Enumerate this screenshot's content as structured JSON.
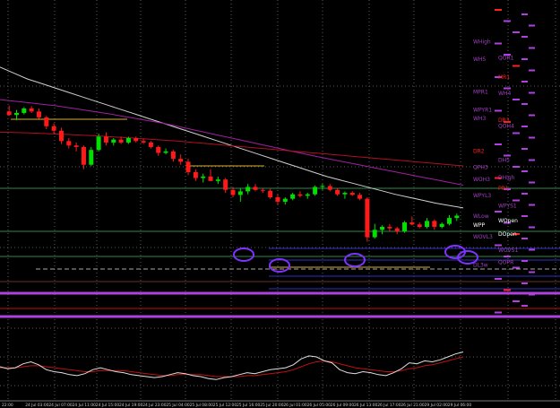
{
  "chart_data": {
    "type": "candlestick",
    "x_ticks": [
      "22:00",
      "24 Jul 03:00",
      "24 Jul 07:00",
      "24 Jul 11:00",
      "24 Jul 15:00",
      "24 Jul 19:00",
      "24 Jul 23:00",
      "25 Jul 04:00",
      "25 Jul 08:00",
      "25 Jul 12:00",
      "25 Jul 16:00",
      "25 Jul 20:00",
      "26 Jul 01:00",
      "26 Jul 05:00",
      "26 Jul 09:00",
      "26 Jul 13:00",
      "26 Jul 17:00",
      "26 Jul 21:00",
      "29 Jul 02:00",
      "29 Jul 06:00"
    ],
    "candles": [
      {
        "o": 69.0,
        "h": 71.0,
        "l": 67.5,
        "c": 67.8
      },
      {
        "o": 67.8,
        "h": 69.5,
        "l": 66.0,
        "c": 68.5
      },
      {
        "o": 68.5,
        "h": 70.5,
        "l": 68.0,
        "c": 70.0
      },
      {
        "o": 70.0,
        "h": 70.8,
        "l": 68.5,
        "c": 69.0
      },
      {
        "o": 69.0,
        "h": 70.0,
        "l": 66.5,
        "c": 67.0
      },
      {
        "o": 67.0,
        "h": 67.5,
        "l": 63.0,
        "c": 64.0
      },
      {
        "o": 64.0,
        "h": 65.0,
        "l": 61.5,
        "c": 62.5
      },
      {
        "o": 62.5,
        "h": 63.5,
        "l": 58.0,
        "c": 59.0
      },
      {
        "o": 59.0,
        "h": 60.0,
        "l": 56.5,
        "c": 57.5
      },
      {
        "o": 57.5,
        "h": 58.5,
        "l": 55.5,
        "c": 57.0
      },
      {
        "o": 57.0,
        "h": 57.5,
        "l": 49.5,
        "c": 51.0
      },
      {
        "o": 51.0,
        "h": 57.0,
        "l": 50.5,
        "c": 56.0
      },
      {
        "o": 56.0,
        "h": 61.5,
        "l": 55.5,
        "c": 60.5
      },
      {
        "o": 60.5,
        "h": 62.0,
        "l": 57.5,
        "c": 58.5
      },
      {
        "o": 58.5,
        "h": 60.0,
        "l": 57.5,
        "c": 59.5
      },
      {
        "o": 59.5,
        "h": 60.5,
        "l": 58.0,
        "c": 58.5
      },
      {
        "o": 58.5,
        "h": 60.5,
        "l": 58.0,
        "c": 60.0
      },
      {
        "o": 60.0,
        "h": 60.5,
        "l": 58.5,
        "c": 59.0
      },
      {
        "o": 59.0,
        "h": 59.8,
        "l": 58.0,
        "c": 58.5
      },
      {
        "o": 58.5,
        "h": 59.0,
        "l": 56.5,
        "c": 57.0
      },
      {
        "o": 57.0,
        "h": 57.5,
        "l": 54.0,
        "c": 55.0
      },
      {
        "o": 55.0,
        "h": 56.5,
        "l": 54.5,
        "c": 55.5
      },
      {
        "o": 55.5,
        "h": 56.0,
        "l": 52.0,
        "c": 53.0
      },
      {
        "o": 53.0,
        "h": 54.5,
        "l": 51.0,
        "c": 52.0
      },
      {
        "o": 52.0,
        "h": 53.0,
        "l": 47.5,
        "c": 48.5
      },
      {
        "o": 48.5,
        "h": 49.5,
        "l": 45.5,
        "c": 46.5
      },
      {
        "o": 46.5,
        "h": 48.0,
        "l": 45.0,
        "c": 47.0
      },
      {
        "o": 47.0,
        "h": 49.5,
        "l": 46.5,
        "c": 45.5
      },
      {
        "o": 45.5,
        "h": 47.0,
        "l": 44.5,
        "c": 46.0
      },
      {
        "o": 46.0,
        "h": 46.5,
        "l": 41.5,
        "c": 42.5
      },
      {
        "o": 42.5,
        "h": 43.5,
        "l": 40.0,
        "c": 40.8
      },
      {
        "o": 40.8,
        "h": 43.0,
        "l": 38.5,
        "c": 42.0
      },
      {
        "o": 42.0,
        "h": 44.5,
        "l": 41.0,
        "c": 43.5
      },
      {
        "o": 43.5,
        "h": 44.5,
        "l": 42.0,
        "c": 42.5
      },
      {
        "o": 42.5,
        "h": 43.0,
        "l": 41.5,
        "c": 42.2
      },
      {
        "o": 42.2,
        "h": 42.8,
        "l": 39.5,
        "c": 40.0
      },
      {
        "o": 40.0,
        "h": 41.0,
        "l": 37.5,
        "c": 38.5
      },
      {
        "o": 38.5,
        "h": 40.0,
        "l": 37.5,
        "c": 39.5
      },
      {
        "o": 39.5,
        "h": 41.5,
        "l": 39.0,
        "c": 41.0
      },
      {
        "o": 41.0,
        "h": 42.0,
        "l": 40.0,
        "c": 40.5
      },
      {
        "o": 40.5,
        "h": 41.5,
        "l": 39.5,
        "c": 41.0
      },
      {
        "o": 41.0,
        "h": 44.0,
        "l": 40.5,
        "c": 43.5
      },
      {
        "o": 43.5,
        "h": 44.5,
        "l": 42.5,
        "c": 43.8
      },
      {
        "o": 43.8,
        "h": 44.5,
        "l": 42.0,
        "c": 42.5
      },
      {
        "o": 42.5,
        "h": 43.0,
        "l": 40.5,
        "c": 41.0
      },
      {
        "o": 41.0,
        "h": 42.0,
        "l": 39.5,
        "c": 41.5
      },
      {
        "o": 41.5,
        "h": 42.0,
        "l": 40.5,
        "c": 40.8
      },
      {
        "o": 40.8,
        "h": 41.5,
        "l": 39.0,
        "c": 39.5
      },
      {
        "o": 39.5,
        "h": 40.0,
        "l": 25.0,
        "c": 26.5
      },
      {
        "o": 26.5,
        "h": 31.0,
        "l": 26.0,
        "c": 29.0
      },
      {
        "o": 29.0,
        "h": 30.5,
        "l": 27.5,
        "c": 30.0
      },
      {
        "o": 30.0,
        "h": 31.0,
        "l": 28.5,
        "c": 29.5
      },
      {
        "o": 29.5,
        "h": 30.0,
        "l": 27.5,
        "c": 28.5
      },
      {
        "o": 28.5,
        "h": 32.0,
        "l": 28.0,
        "c": 31.5
      },
      {
        "o": 31.5,
        "h": 33.5,
        "l": 30.5,
        "c": 30.8
      },
      {
        "o": 30.8,
        "h": 31.5,
        "l": 29.5,
        "c": 30.0
      },
      {
        "o": 30.0,
        "h": 33.0,
        "l": 29.5,
        "c": 32.0
      },
      {
        "o": 32.0,
        "h": 32.5,
        "l": 29.0,
        "c": 30.0
      },
      {
        "o": 30.0,
        "h": 31.5,
        "l": 29.5,
        "c": 31.0
      },
      {
        "o": 31.0,
        "h": 34.0,
        "l": 30.5,
        "c": 33.0
      },
      {
        "o": 33.0,
        "h": 34.5,
        "l": 32.0,
        "c": 33.8
      }
    ],
    "moving_averages": [
      {
        "color": "#cfcfcf",
        "values": [
          84,
          82,
          80,
          78.5,
          77,
          75.5,
          74,
          72.5,
          71,
          69.5,
          68,
          66.5,
          65,
          63.5,
          62,
          60.5,
          59,
          57.5,
          56,
          54.5,
          53,
          51.5,
          50,
          48.5,
          47,
          45.8,
          44.6,
          43.4,
          42.2,
          41,
          40,
          39,
          38,
          37.2,
          36.4
        ]
      },
      {
        "color": "#a020a0",
        "values": [
          73,
          72.5,
          72,
          71.5,
          71,
          70.3,
          69.6,
          68.9,
          68.2,
          67.4,
          66.6,
          65.8,
          65,
          64,
          63,
          62,
          61,
          60,
          59,
          58,
          57,
          56,
          55,
          54,
          53.1,
          52.2,
          51.3,
          50.4,
          49.5,
          48.6,
          47.7,
          46.8,
          45.9,
          45,
          44.1
        ]
      },
      {
        "color": "#b01020",
        "values": [
          62,
          61.9,
          61.8,
          61.6,
          61.4,
          61.2,
          61,
          60.8,
          60.5,
          60.2,
          59.9,
          59.6,
          59.3,
          59,
          58.6,
          58.2,
          57.8,
          57.4,
          57,
          56.6,
          56.2,
          55.8,
          55.4,
          55,
          54.6,
          54.2,
          53.8,
          53.4,
          53,
          52.6,
          52.2,
          51.8,
          51.4,
          51,
          50.6
        ]
      }
    ],
    "level_labels": [
      {
        "text": "WHigh",
        "y": 92,
        "color": "#a040c0"
      },
      {
        "text": "QOR1",
        "y": 86.5,
        "color": "#a040c0"
      },
      {
        "text": "WH5",
        "y": 86,
        "color": "#a040c0"
      },
      {
        "text": "MR1",
        "y": 80,
        "color": "#ff2020"
      },
      {
        "text": "MPR1",
        "y": 75,
        "color": "#a040c0"
      },
      {
        "text": "WH4",
        "y": 74.5,
        "color": "#a040c0"
      },
      {
        "text": "WPYR1",
        "y": 69,
        "color": "#a040c0"
      },
      {
        "text": "DR3",
        "y": 65.5,
        "color": "#ff2020"
      },
      {
        "text": "WH3",
        "y": 66,
        "color": "#a040c0"
      },
      {
        "text": "QOH4",
        "y": 63.5,
        "color": "#a040c0"
      },
      {
        "text": "DR2",
        "y": 55,
        "color": "#ff2020"
      },
      {
        "text": "DH5",
        "y": 52,
        "color": "#a040c0"
      },
      {
        "text": "QPH3",
        "y": 49.5,
        "color": "#a040c0"
      },
      {
        "text": "DHigh",
        "y": 46,
        "color": "#a040c0"
      },
      {
        "text": "WOH3",
        "y": 45.5,
        "color": "#a040c0"
      },
      {
        "text": "PR1",
        "y": 42.5,
        "color": "#ff2020"
      },
      {
        "text": "WPYL3",
        "y": 40,
        "color": "#a040c0"
      },
      {
        "text": "WPYS1",
        "y": 36.5,
        "color": "#a040c0"
      },
      {
        "text": "WLow",
        "y": 33,
        "color": "#a040c0"
      },
      {
        "text": "WOpen",
        "y": 31.5,
        "color": "#ffffff"
      },
      {
        "text": "WPP",
        "y": 30,
        "color": "#ffffff"
      },
      {
        "text": "DOpen",
        "y": 27,
        "color": "#ffffff"
      },
      {
        "text": "WOVL3",
        "y": 26,
        "color": "#a040c0"
      },
      {
        "text": "WOVS1",
        "y": 21.5,
        "color": "#a040c0"
      },
      {
        "text": "DL3w",
        "y": 16.5,
        "color": "#a040c0"
      },
      {
        "text": "QOPR",
        "y": 17.5,
        "color": "#a040c0"
      }
    ],
    "oscillator": [
      50,
      48,
      49,
      53,
      55,
      52,
      47,
      45,
      44,
      42,
      41,
      43,
      47,
      49,
      47,
      45,
      44,
      42,
      41,
      40,
      39,
      40,
      42,
      44,
      43,
      41,
      40,
      38,
      37,
      39,
      40,
      42,
      44,
      43,
      45,
      47,
      48,
      49,
      52,
      58,
      61,
      60,
      56,
      54,
      47,
      44,
      43,
      45,
      44,
      42,
      41,
      44,
      48,
      54,
      53,
      56,
      55,
      57,
      60,
      63,
      65
    ],
    "oscillator_signal": [
      49,
      49,
      49,
      50,
      51,
      51,
      50,
      49,
      48,
      47,
      46,
      45,
      45,
      46,
      46,
      46,
      46,
      45,
      44,
      43,
      42,
      41,
      41,
      42,
      42,
      42,
      42,
      41,
      40,
      40,
      40,
      40,
      41,
      41,
      42,
      43,
      44,
      45,
      47,
      50,
      53,
      55,
      56,
      55,
      53,
      51,
      49,
      48,
      47,
      46,
      45,
      45,
      46,
      48,
      49,
      51,
      52,
      54,
      56,
      58,
      60
    ]
  }
}
